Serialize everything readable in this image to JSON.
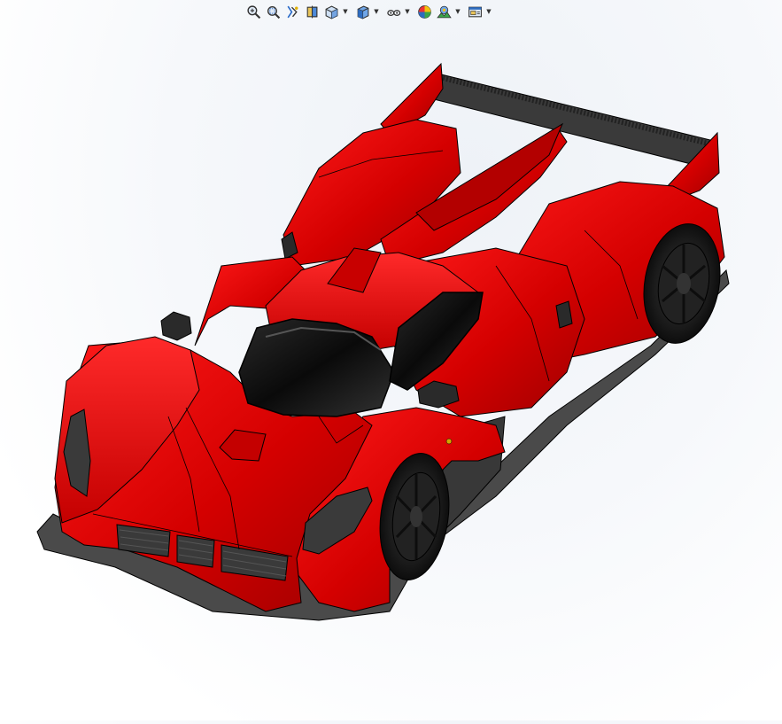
{
  "window": {
    "background_top": "#eef2f7",
    "background_bottom": "#ffffff"
  },
  "heads_up_toolbar": {
    "buttons": [
      {
        "id": "zoom-to-fit",
        "icon": "zoom-to-fit-icon",
        "has_dropdown": false
      },
      {
        "id": "zoom-to-area",
        "icon": "zoom-to-area-icon",
        "has_dropdown": false
      },
      {
        "id": "previous-view",
        "icon": "previous-view-icon",
        "has_dropdown": false
      },
      {
        "id": "section-view",
        "icon": "section-view-icon",
        "has_dropdown": false
      },
      {
        "id": "view-orientation",
        "icon": "view-orientation-icon",
        "has_dropdown": true
      },
      {
        "id": "display-style",
        "icon": "display-style-icon",
        "has_dropdown": true
      },
      {
        "id": "hide-show-items",
        "icon": "hide-show-items-icon",
        "has_dropdown": true
      },
      {
        "id": "edit-appearance",
        "icon": "edit-appearance-icon",
        "has_dropdown": false
      },
      {
        "id": "apply-scene",
        "icon": "apply-scene-icon",
        "has_dropdown": true
      },
      {
        "id": "view-settings",
        "icon": "view-settings-icon",
        "has_dropdown": true
      }
    ]
  },
  "model": {
    "name_icon": "race-car-model",
    "body_color": "#d40000",
    "body_shade_color": "#9e0000",
    "carbon_color": "#333333",
    "glass_color": "#111111",
    "wheel_color": "#1c1c1c",
    "edge_color": "#000000"
  }
}
